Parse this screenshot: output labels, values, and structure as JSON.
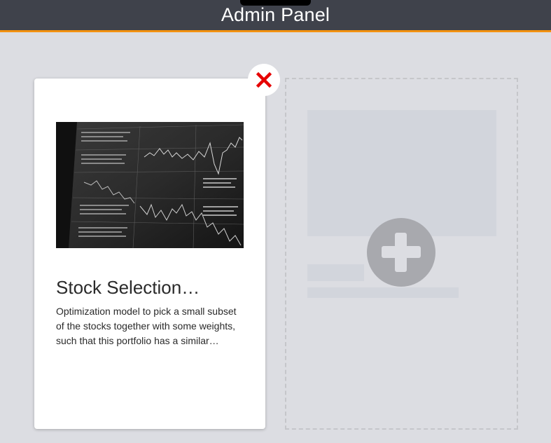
{
  "header": {
    "title": "Admin Panel",
    "accent_color": "#f29111",
    "background_color": "#3f424b"
  },
  "cards": [
    {
      "title": "Stock Selection…",
      "description": "Optimization model to pick a small subset of the stocks together with some weights, such that this portfolio has a similar…",
      "image": "stock-market-charts-monitor"
    }
  ],
  "delete_button": {
    "icon": "close-icon",
    "color": "#e60000"
  },
  "add_placeholder": {
    "icon": "plus-icon"
  }
}
